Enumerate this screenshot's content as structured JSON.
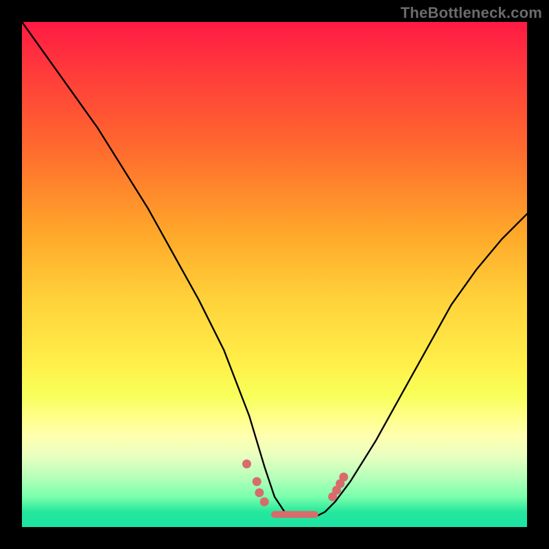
{
  "watermark": "TheBottleneck.com",
  "colors": {
    "background": "#000000",
    "gradient_top": "#ff1a44",
    "gradient_bottom": "#1de3a3",
    "curve": "#000000",
    "marker": "#d86b6b"
  },
  "chart_data": {
    "type": "line",
    "title": "",
    "xlabel": "",
    "ylabel": "",
    "xlim": [
      0,
      100
    ],
    "ylim": [
      0,
      100
    ],
    "grid": false,
    "series": [
      {
        "name": "bottleneck-curve",
        "x": [
          0,
          5,
          10,
          15,
          20,
          25,
          30,
          35,
          40,
          45,
          48,
          50,
          52,
          54,
          56,
          58,
          60,
          62,
          65,
          70,
          75,
          80,
          85,
          90,
          95,
          100
        ],
        "y": [
          100,
          93,
          86,
          79,
          71,
          63,
          54,
          45,
          35,
          22,
          12,
          6,
          3,
          2,
          2,
          2,
          3,
          5,
          9,
          17,
          26,
          35,
          44,
          51,
          57,
          62
        ]
      }
    ],
    "markers": [
      {
        "x": 44.5,
        "y": 12.5
      },
      {
        "x": 46.5,
        "y": 9.0
      },
      {
        "x": 47.0,
        "y": 6.8
      },
      {
        "x": 48.0,
        "y": 5.0
      },
      {
        "x": 61.5,
        "y": 6.0
      },
      {
        "x": 62.3,
        "y": 7.3
      },
      {
        "x": 63.0,
        "y": 8.6
      },
      {
        "x": 63.7,
        "y": 9.9
      }
    ],
    "flat_segment": {
      "x_start": 50,
      "x_end": 58,
      "y": 2.5
    }
  }
}
